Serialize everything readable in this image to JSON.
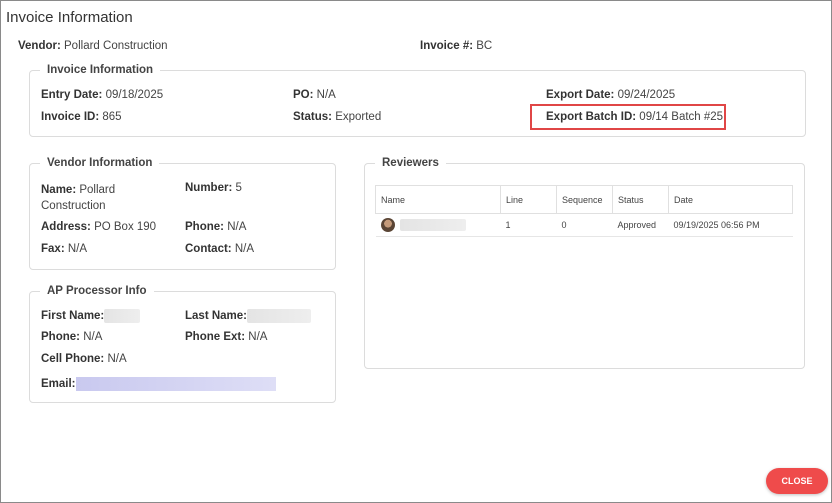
{
  "dialog": {
    "title": "Invoice Information",
    "vendor_label": "Vendor:",
    "vendor_value": "Pollard Construction",
    "invoice_num_label": "Invoice #:",
    "invoice_num_value": "BC"
  },
  "invoice_info": {
    "legend": "Invoice Information",
    "entry_date_label": "Entry Date:",
    "entry_date_value": "09/18/2025",
    "invoice_id_label": "Invoice ID:",
    "invoice_id_value": "865",
    "po_label": "PO:",
    "po_value": "N/A",
    "status_label": "Status:",
    "status_value": "Exported",
    "export_date_label": "Export Date:",
    "export_date_value": "09/24/2025",
    "export_batch_label": "Export Batch ID:",
    "export_batch_value": "09/14 Batch #25",
    "highlight_color": "#e04646"
  },
  "vendor_info": {
    "legend": "Vendor Information",
    "name_label": "Name:",
    "name_value_line1": "Pollard",
    "name_value_line2": "Construction",
    "number_label": "Number:",
    "number_value": "5",
    "address_label": "Address:",
    "address_value": "PO Box 190",
    "phone_label": "Phone:",
    "phone_value": "N/A",
    "fax_label": "Fax:",
    "fax_value": "N/A",
    "contact_label": "Contact:",
    "contact_value": "N/A"
  },
  "ap_processor": {
    "legend": "AP Processor Info",
    "first_name_label": "First Name:",
    "last_name_label": "Last Name:",
    "phone_label": "Phone:",
    "phone_value": "N/A",
    "phone_ext_label": "Phone Ext:",
    "phone_ext_value": "N/A",
    "cell_phone_label": "Cell Phone:",
    "cell_phone_value": "N/A",
    "email_label": "Email:"
  },
  "reviewers": {
    "legend": "Reviewers",
    "columns": [
      "Name",
      "Line",
      "Sequence",
      "Status",
      "Date"
    ],
    "rows": [
      {
        "line": "1",
        "sequence": "0",
        "status": "Approved",
        "date": "09/19/2025 06:56 PM"
      }
    ]
  },
  "footer": {
    "close_label": "CLOSE",
    "close_color": "#ef4b4b"
  }
}
